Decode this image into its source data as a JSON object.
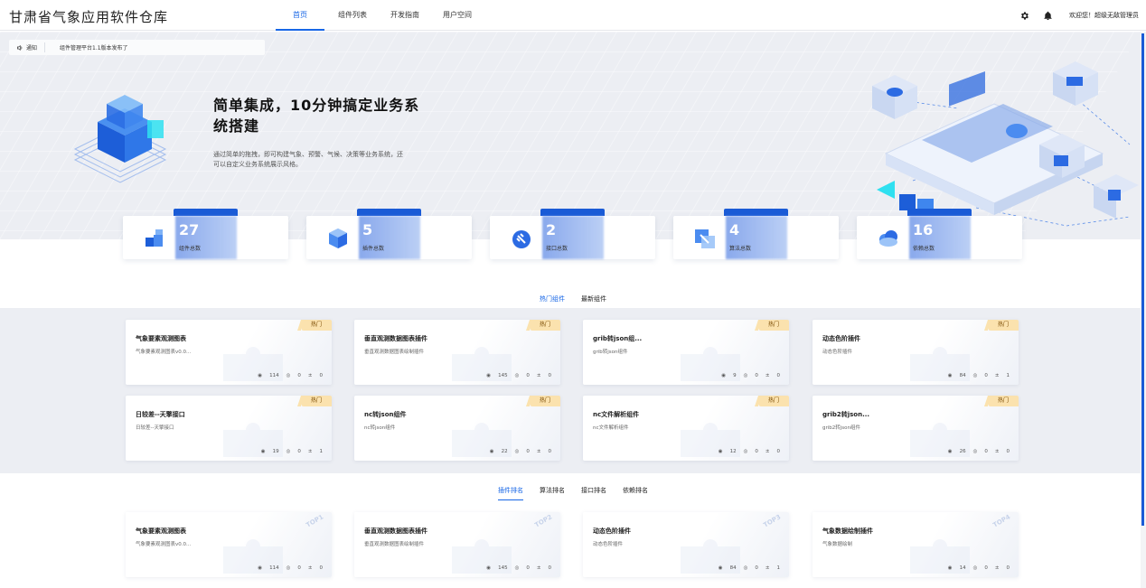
{
  "header": {
    "brand": "甘肃省气象应用软件仓库",
    "nav": [
      "首页",
      "组件列表",
      "开发指南",
      "用户空间"
    ],
    "welcome": "欢迎您！超级无敌管理员"
  },
  "notice": {
    "tag": "通知",
    "text": "组件管理平台1.1版本发布了"
  },
  "hero": {
    "title": "简单集成，10分钟搞定业务系统搭建",
    "desc": "通过简单的拖拽，即可构建气象、预警、气候、决策等业务系统，还可以自定义业务系统展示风格。"
  },
  "stats": [
    {
      "num": "27",
      "label": "组件总数",
      "icon": "component-icon"
    },
    {
      "num": "5",
      "label": "插件总数",
      "icon": "plugin-icon"
    },
    {
      "num": "2",
      "label": "接口总数",
      "icon": "interface-icon"
    },
    {
      "num": "4",
      "label": "算法总数",
      "icon": "algorithm-icon"
    },
    {
      "num": "16",
      "label": "依赖总数",
      "icon": "dependency-icon"
    }
  ],
  "tabs1": [
    "热门组件",
    "最新组件"
  ],
  "hot_label": "热门",
  "hot_cards": [
    {
      "title": "气象要素观测图表",
      "sub": "气象要素观测图表v0.0...",
      "views": "114",
      "likes": "0",
      "downloads": "0"
    },
    {
      "title": "垂直观测数据图表插件",
      "sub": "垂直观测数据图表绘制插件",
      "views": "145",
      "likes": "0",
      "downloads": "0"
    },
    {
      "title": "grib转json组...",
      "sub": "grib转json组件",
      "views": "9",
      "likes": "0",
      "downloads": "0"
    },
    {
      "title": "动态色阶插件",
      "sub": "动态色阶插件",
      "views": "84",
      "likes": "0",
      "downloads": "1"
    },
    {
      "title": "日较差--天擎接口",
      "sub": "日较差--天擎接口",
      "views": "19",
      "likes": "0",
      "downloads": "1"
    },
    {
      "title": "nc转json组件",
      "sub": "nc转json组件",
      "views": "22",
      "likes": "0",
      "downloads": "0"
    },
    {
      "title": "nc文件解析组件",
      "sub": "nc文件解析组件",
      "views": "12",
      "likes": "0",
      "downloads": "0"
    },
    {
      "title": "grib2转json...",
      "sub": "grib2转json组件",
      "views": "26",
      "likes": "0",
      "downloads": "0"
    }
  ],
  "tabs2": [
    "插件排名",
    "算法排名",
    "接口排名",
    "依赖排名"
  ],
  "rank_cards": [
    {
      "title": "气象要素观测图表",
      "sub": "气象要素观测图表v0.0...",
      "views": "114",
      "likes": "0",
      "downloads": "0",
      "top": "TOP1"
    },
    {
      "title": "垂直观测数据图表插件",
      "sub": "垂直观测数据图表绘制插件",
      "views": "145",
      "likes": "0",
      "downloads": "0",
      "top": "TOP2"
    },
    {
      "title": "动态色阶插件",
      "sub": "动态色阶插件",
      "views": "84",
      "likes": "0",
      "downloads": "1",
      "top": "TOP3"
    },
    {
      "title": "气象数据绘制插件",
      "sub": "气象数据绘制",
      "views": "14",
      "likes": "0",
      "downloads": "0",
      "top": "TOP4"
    }
  ],
  "colors": {
    "accent": "#1766e6",
    "hot": "#fbe2ae",
    "stat_tab": "#1a5bd6"
  }
}
